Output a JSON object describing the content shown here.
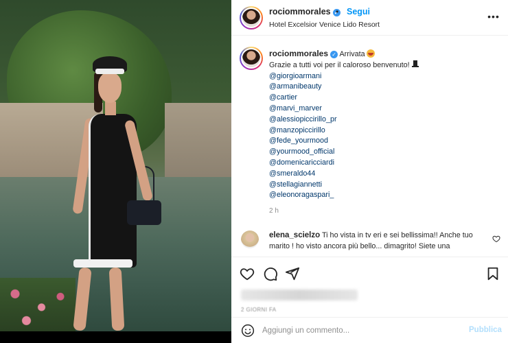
{
  "header": {
    "username": "rociommorales",
    "separator": "•",
    "follow_label": "Segui",
    "location": "Hotel Excelsior Venice Lido Resort",
    "more_icon": "more-horizontal-icon"
  },
  "caption": {
    "username": "rociommorales",
    "first_line": "Arrivata",
    "second_line": "Grazie a tutti voi per il caloroso benvenuto!",
    "mentions": [
      "@giorgioarmani",
      "@armanibeauty",
      "@cartier",
      "@marvi_marver",
      "@alessiopiccirillo_pr",
      "@manzopiccirillo",
      "@fede_yourmood",
      "@yourmood_official",
      "@domenicaricciardi",
      "@smeraldo44",
      "@stellagiannetti",
      "@eleonoragaspari_"
    ],
    "time": "2 h"
  },
  "comment": {
    "username": "elena_scielzo",
    "text": "Ti ho vista in tv eri e sei bellissima!! Anche tuo marito ! ho visto ancora più bello... dimagrito! Siete una"
  },
  "footer": {
    "date_label": "2 GIORNI FA",
    "comment_placeholder": "Aggiungi un commento...",
    "publish_label": "Pubblica"
  },
  "colors": {
    "link_blue": "#0095f6",
    "mention_blue": "#00376b",
    "muted": "#8e8e8e",
    "publish_disabled": "#b2dffc"
  }
}
